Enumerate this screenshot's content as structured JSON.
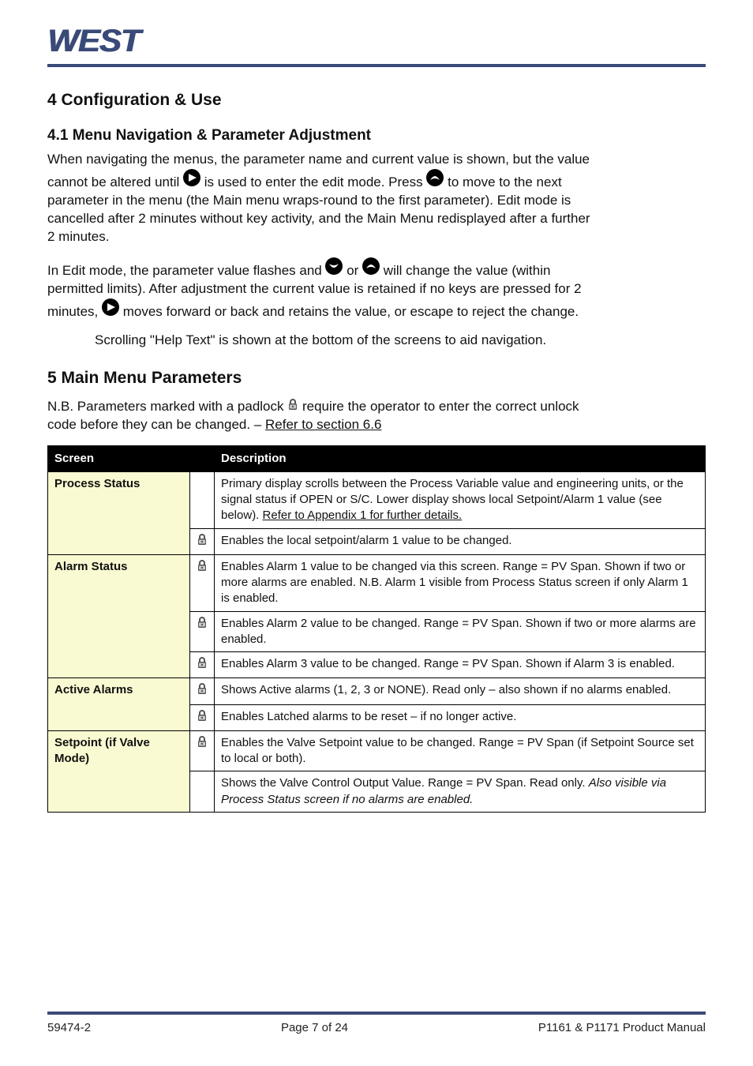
{
  "logo_text": "WEST",
  "heading_main": "4 Configuration & Use",
  "heading_sub": "4.1 Menu Navigation & Parameter Adjustment",
  "nav": {
    "p1": "When navigating the menus, the parameter name and current value is shown, but the value",
    "p2_a": "cannot be altered until ",
    "p2_b": " is used to enter the edit mode. Press ",
    "p2_c": " to move to the next",
    "p3": "parameter in the menu (the Main menu wraps-round to the first parameter). Edit mode is",
    "p4a": "cancelled after 2 minutes without key activity, and the Main Menu redisplayed after a further",
    "p4b": "2 minutes.",
    "p5_a": "In Edit mode, the parameter value flashes and ",
    "p5_b": " or ",
    "p5_c": " will change the value (within",
    "p6": "permitted limits). After adjustment the current value is retained if no keys are pressed for 2",
    "p7_a": "minutes, ",
    "p7_b": " moves forward or back and retains the value, or escape to reject the change.",
    "note": "Scrolling \"Help Text\" is shown at the bottom of the screens to aid navigation."
  },
  "section5": {
    "title": "5 Main Menu Parameters",
    "intro_a": "N.B. Parameters marked with a padlock ",
    "intro_b": " require the operator to enter the correct unlock",
    "intro_c": "code before they can be changed. – ",
    "intro_link": "Refer to section 6.6"
  },
  "table": {
    "headers": [
      "Screen",
      "",
      "Description"
    ],
    "rows": [
      {
        "screen": "Process Status",
        "lock": false,
        "desc_a": "Primary display scrolls between the Process Variable value and engineering units, or the signal status if OPEN or S/C. Lower display shows local Setpoint/Alarm 1 value (see below). ",
        "desc_link": "Refer to Appendix 1 for further details."
      },
      {
        "screen": "",
        "lock": true,
        "desc": "Enables the local setpoint/alarm 1 value to be changed."
      },
      {
        "screen": "Alarm Status",
        "lock": true,
        "desc": "Enables Alarm 1 value to be changed via this screen. Range = PV Span. Shown if two or more alarms are enabled. N.B. Alarm 1 visible from Process Status screen if only Alarm 1 is enabled."
      },
      {
        "screen": "",
        "lock": true,
        "desc": "Enables Alarm 2 value to be changed. Range = PV Span. Shown if two or more alarms are enabled."
      },
      {
        "screen": "",
        "lock": true,
        "desc": "Enables Alarm 3 value to be changed. Range = PV Span. Shown if Alarm 3 is enabled."
      },
      {
        "screen": "Active Alarms",
        "lock": true,
        "desc": "Shows Active alarms (1, 2, 3 or NONE). Read only – also shown if no alarms enabled."
      },
      {
        "screen": "",
        "lock": true,
        "desc": "Enables Latched alarms to be reset – if no longer active."
      },
      {
        "screen": "Setpoint (if Valve Mode)",
        "lock": true,
        "desc": "Enables the Valve Setpoint value to be changed. Range = PV Span (if Setpoint Source set to local or both)."
      },
      {
        "screen": "",
        "lock": false,
        "desc_a": "Shows the Valve Control Output Value. Range = PV Span. Read only. ",
        "desc_b": "Also visible via Process Status screen if no alarms are enabled."
      }
    ]
  },
  "footer": {
    "left": "59474-2",
    "center": "Page 7 of 24",
    "right": "P1161 & P1171 Product Manual"
  }
}
